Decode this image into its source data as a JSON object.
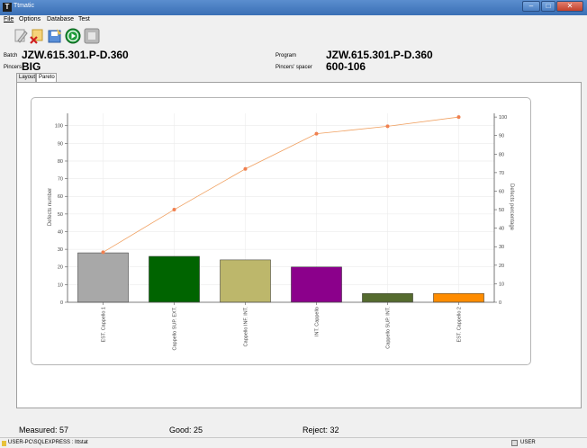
{
  "window": {
    "title": "Ttmatic",
    "minimize": "–",
    "maximize": "□",
    "close": "✕"
  },
  "menu": [
    "File",
    "Options",
    "Database",
    "Test"
  ],
  "toolbar": {
    "icons": [
      "edit-icon",
      "delete-icon",
      "save-icon",
      "play-icon",
      "stop-icon"
    ]
  },
  "info": {
    "batch_label": "Batch",
    "batch_value": "JZW.615.301.P-D.360",
    "pincers_label": "Pincers",
    "pincers_value": "BIG",
    "program_label": "Program",
    "program_value": "JZW.615.301.P-D.360",
    "spacer_label": "Pincers' spacer",
    "spacer_value": "600-106"
  },
  "tabs": [
    {
      "label": "Layout"
    },
    {
      "label": "Pareto"
    }
  ],
  "stats": {
    "measured": "Measured: 57",
    "good": "Good: 25",
    "reject": "Reject: 32"
  },
  "status": {
    "left": "USER-PC\\SQLEXPRESS : Ittstat",
    "right": "USER"
  },
  "colors": {
    "accent": "#3a6fb5",
    "line": "#f0a060"
  },
  "chart_data": {
    "type": "bar",
    "categories": [
      "EST. Cappello 1",
      "Cappello SUP. EXT.",
      "Cappello INF. INT.",
      "INT. Cappello",
      "Cappello SUP. INT.",
      "EST. Cappello 2"
    ],
    "values": [
      28,
      26,
      24,
      20,
      5,
      5
    ],
    "colors": [
      "#a8a8a8",
      "#006400",
      "#bdb76b",
      "#8b008b",
      "#556b2f",
      "#ff8c00"
    ],
    "series": [
      {
        "name": "Defects number",
        "values": [
          28,
          26,
          24,
          20,
          5,
          5
        ]
      },
      {
        "name": "Defects percentage",
        "values": [
          27,
          50,
          72,
          91,
          95,
          100
        ]
      }
    ],
    "ylabel": "Defects number",
    "y2label": "Defects percentage",
    "ylim": [
      0,
      107
    ],
    "y2lim": [
      0,
      102
    ],
    "yticks": [
      0,
      10,
      20,
      30,
      40,
      50,
      60,
      70,
      80,
      90,
      100
    ],
    "grid": true
  }
}
